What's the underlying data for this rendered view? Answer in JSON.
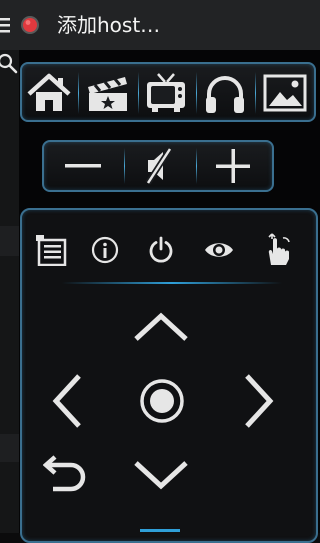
{
  "app": {
    "title": "添加host…"
  },
  "colors": {
    "accent": "#2f9fd8",
    "panel_border": "#3a6f8f",
    "status_dot": "#e0393e",
    "icon": "#e6e6e6"
  },
  "navigation_row": [
    {
      "id": "home",
      "icon": "home-icon"
    },
    {
      "id": "movies",
      "icon": "movies-clapper-icon"
    },
    {
      "id": "tv",
      "icon": "tv-icon"
    },
    {
      "id": "music",
      "icon": "headphones-icon"
    },
    {
      "id": "pictures",
      "icon": "picture-icon"
    }
  ],
  "volume_row": [
    {
      "id": "volume-down",
      "icon": "minus-icon"
    },
    {
      "id": "mute",
      "icon": "mute-icon"
    },
    {
      "id": "volume-up",
      "icon": "plus-icon"
    }
  ],
  "control_row": [
    {
      "id": "menu",
      "icon": "list-menu-icon"
    },
    {
      "id": "info",
      "icon": "info-icon"
    },
    {
      "id": "power",
      "icon": "power-icon"
    },
    {
      "id": "view",
      "icon": "eye-icon"
    },
    {
      "id": "gesture",
      "icon": "touch-gesture-icon"
    }
  ],
  "dpad": [
    {
      "id": "up",
      "icon": "chevron-up-icon"
    },
    {
      "id": "left",
      "icon": "chevron-left-icon"
    },
    {
      "id": "select",
      "icon": "select-circle-icon"
    },
    {
      "id": "right",
      "icon": "chevron-right-icon"
    },
    {
      "id": "back",
      "icon": "back-arrow-icon"
    },
    {
      "id": "down",
      "icon": "chevron-down-icon"
    }
  ]
}
